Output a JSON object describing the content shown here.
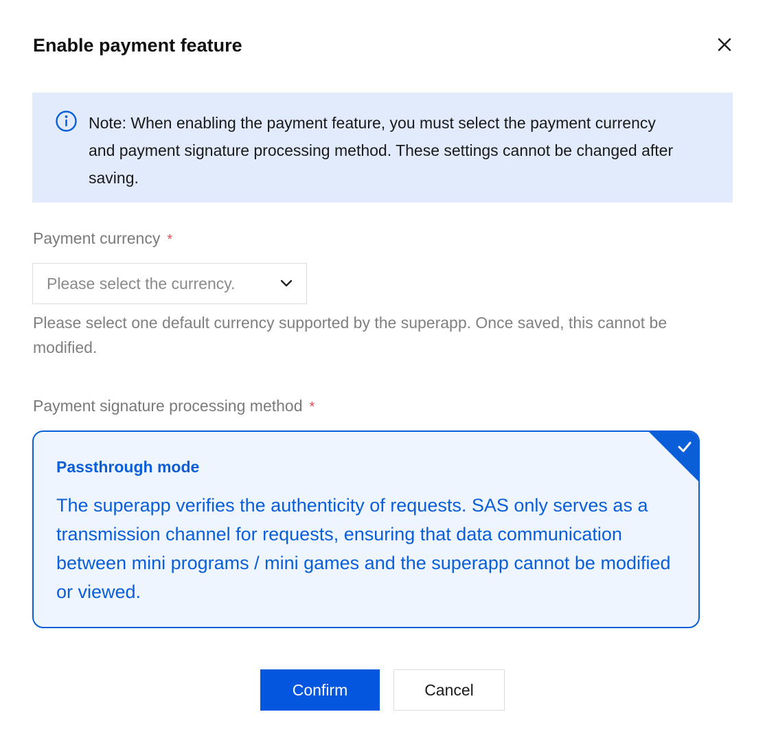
{
  "dialog": {
    "title": "Enable payment feature",
    "close_icon": "close-icon"
  },
  "notice": {
    "icon": "info-circle-icon",
    "text": "Note: When enabling the payment feature, you must select the payment currency and payment signature processing method. These settings cannot be changed after saving."
  },
  "currency": {
    "label": "Payment currency",
    "required_mark": "*",
    "placeholder": "Please select the currency.",
    "chevron_icon": "chevron-down-icon",
    "help": "Please select one default currency supported by the superapp. Once saved, this cannot be modified."
  },
  "signature": {
    "label": "Payment signature processing method",
    "required_mark": "*",
    "option": {
      "title": "Passthrough mode",
      "description": "The superapp verifies the authenticity of requests. SAS only serves as a transmission channel for requests, ensuring that data communication between mini programs / mini games and the superapp cannot be modified or viewed.",
      "selected": true,
      "check_icon": "check-icon"
    }
  },
  "actions": {
    "confirm_label": "Confirm",
    "cancel_label": "Cancel"
  },
  "colors": {
    "primary": "#0456de",
    "accent_text": "#0a5ed8",
    "notice_bg": "#e1ebfc",
    "option_bg": "#eef5fe",
    "required": "#e34d59"
  }
}
